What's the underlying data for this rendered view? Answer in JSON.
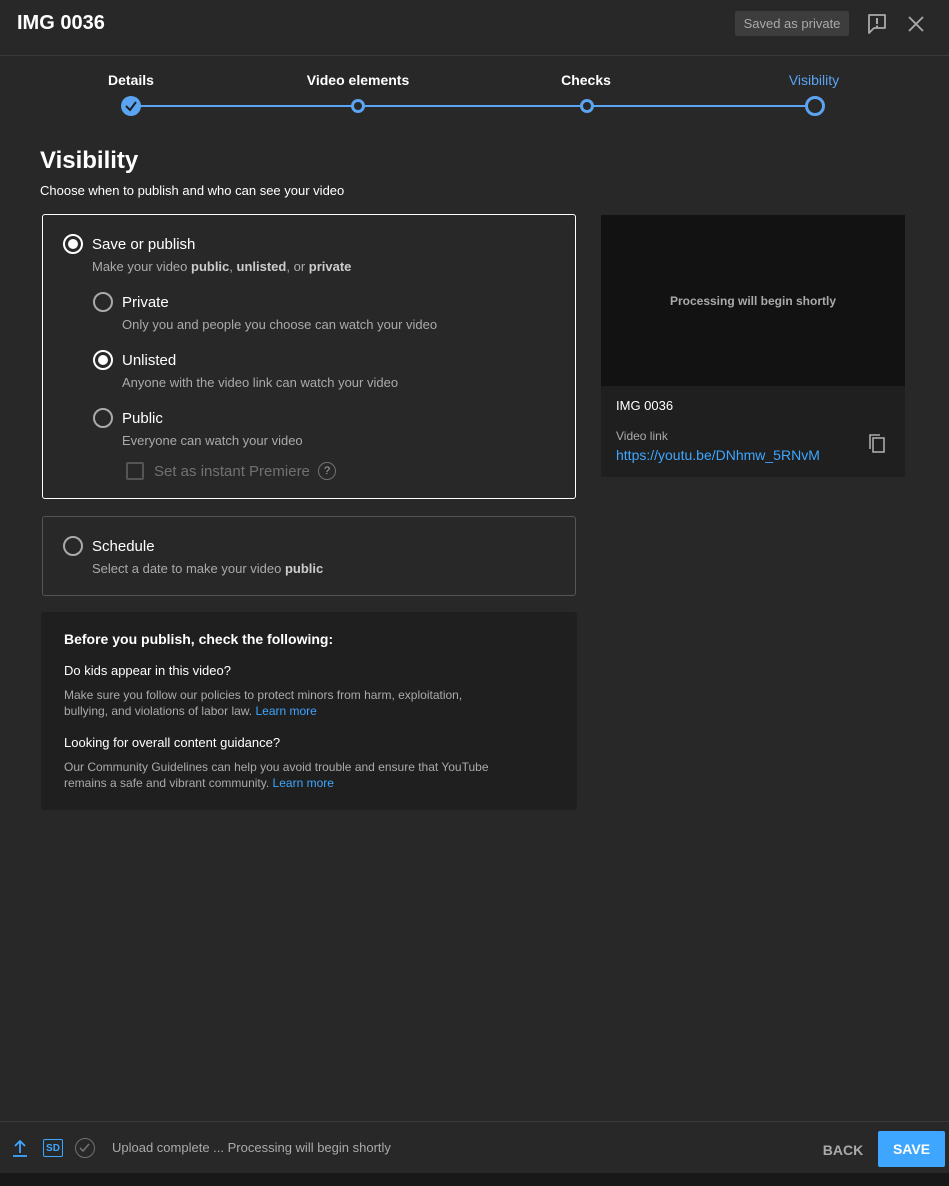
{
  "header": {
    "title": "IMG 0036",
    "saved_badge": "Saved as private"
  },
  "stepper": {
    "steps": [
      {
        "label": "Details",
        "state": "done"
      },
      {
        "label": "Video elements",
        "state": "visited"
      },
      {
        "label": "Checks",
        "state": "visited"
      },
      {
        "label": "Visibility",
        "state": "current"
      }
    ]
  },
  "visibility": {
    "title": "Visibility",
    "subtitle": "Choose when to publish and who can see your video",
    "save_or_publish": {
      "label": "Save or publish",
      "desc_prefix": "Make your video ",
      "desc_public": "public",
      "desc_sep1": ", ",
      "desc_unlisted": "unlisted",
      "desc_sep2": ", or ",
      "desc_private": "private",
      "selected": true
    },
    "options": [
      {
        "label": "Private",
        "desc": "Only you and people you choose can watch your video",
        "selected": false
      },
      {
        "label": "Unlisted",
        "desc": "Anyone with the video link can watch your video",
        "selected": true
      },
      {
        "label": "Public",
        "desc": "Everyone can watch your video",
        "selected": false
      }
    ],
    "premiere_label": "Set as instant Premiere",
    "help_glyph": "?",
    "schedule": {
      "label": "Schedule",
      "desc_prefix": "Select a date to make your video ",
      "desc_bold": "public",
      "selected": false
    }
  },
  "checklist": {
    "title": "Before you publish, check the following:",
    "q1": "Do kids appear in this video?",
    "t1": "Make sure you follow our policies to protect minors from harm, exploitation, bullying, and violations of labor law.",
    "q2": "Looking for overall content guidance?",
    "t2": "Our Community Guidelines can help you avoid trouble and ensure that YouTube remains a safe and vibrant community.",
    "learn_more": "Learn more"
  },
  "preview": {
    "processing": "Processing will begin shortly",
    "filename": "IMG 0036",
    "link_label": "Video link",
    "link": "https://youtu.be/DNhmw_5RNvM"
  },
  "footer": {
    "sd_badge": "SD",
    "status": "Upload complete ... Processing will begin shortly",
    "back": "BACK",
    "save": "SAVE"
  },
  "colors": {
    "background": "#282828",
    "accent": "#3ea6ff",
    "stepper": "#5ba4f2"
  },
  "icons": [
    "feedback-icon",
    "close-icon",
    "checkmark-icon",
    "help-icon",
    "copy-icon",
    "upload-icon",
    "sd-icon",
    "check-circle-icon"
  ]
}
